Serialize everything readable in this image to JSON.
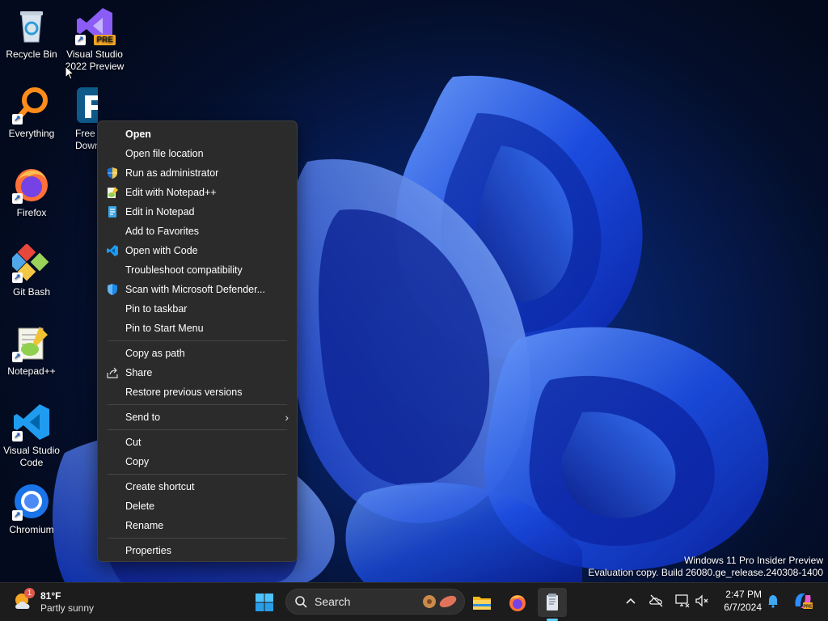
{
  "desktop": {
    "icons": [
      {
        "label": "Recycle Bin",
        "icon": "recycle-bin-icon"
      },
      {
        "label": "Visual Studio\n2022 Preview",
        "icon": "visual-studio-preview-icon",
        "badge": "PRE"
      },
      {
        "label": "Everything",
        "icon": "everything-search-icon"
      },
      {
        "label": "Free\nDown",
        "icon": "free-download-manager-icon"
      },
      {
        "label": "Firefox",
        "icon": "firefox-icon"
      },
      {
        "label": "Git Bash",
        "icon": "git-bash-icon"
      },
      {
        "label": "Notepad++",
        "icon": "notepad-plus-plus-icon"
      },
      {
        "label": "Visual Studio\nCode",
        "icon": "vscode-icon"
      },
      {
        "label": "Chromium",
        "icon": "chromium-icon"
      }
    ]
  },
  "context_menu": {
    "items": [
      {
        "label": "Open",
        "bold": true
      },
      {
        "label": "Open file location"
      },
      {
        "label": "Run as administrator",
        "icon": "uac-shield-icon"
      },
      {
        "label": "Edit with Notepad++",
        "icon": "notepad-plus-plus-icon"
      },
      {
        "label": "Edit in Notepad",
        "icon": "notepad-icon"
      },
      {
        "label": "Add to Favorites"
      },
      {
        "label": "Open with Code",
        "icon": "vscode-icon"
      },
      {
        "label": "Troubleshoot compatibility"
      },
      {
        "label": "Scan with Microsoft Defender...",
        "icon": "defender-shield-icon"
      },
      {
        "label": "Pin to taskbar"
      },
      {
        "label": "Pin to Start Menu"
      },
      {
        "label": "Copy as path"
      },
      {
        "label": "Share",
        "icon": "share-icon"
      },
      {
        "label": "Restore previous versions"
      },
      {
        "label": "Send to",
        "submenu": true
      },
      {
        "label": "Cut"
      },
      {
        "label": "Copy"
      },
      {
        "label": "Create shortcut"
      },
      {
        "label": "Delete"
      },
      {
        "label": "Rename"
      },
      {
        "label": "Properties"
      }
    ]
  },
  "watermark": {
    "line1": "Windows 11 Pro Insider Preview",
    "line2": "Evaluation copy. Build 26080.ge_release.240308-1400"
  },
  "taskbar": {
    "weather": {
      "temp": "81°F",
      "condition": "Partly sunny",
      "alert_badge": "1"
    },
    "search": {
      "placeholder": "Search"
    },
    "pinned": [
      "start-icon",
      "file-explorer-icon",
      "firefox-icon",
      "notepad-app-icon"
    ],
    "tray": [
      "chevron-up-icon",
      "onedrive-off-icon",
      "network-icon",
      "volume-muted-icon",
      "notification-bell-icon",
      "copilot-icon"
    ],
    "clock": {
      "time": "2:47 PM",
      "date": "6/7/2024"
    }
  },
  "colors": {
    "menu_bg": "#2b2b2b",
    "taskbar_bg": "#1c1c1c",
    "accent": "#60cdff",
    "wallpaper_blue": "#1f4fe0"
  }
}
